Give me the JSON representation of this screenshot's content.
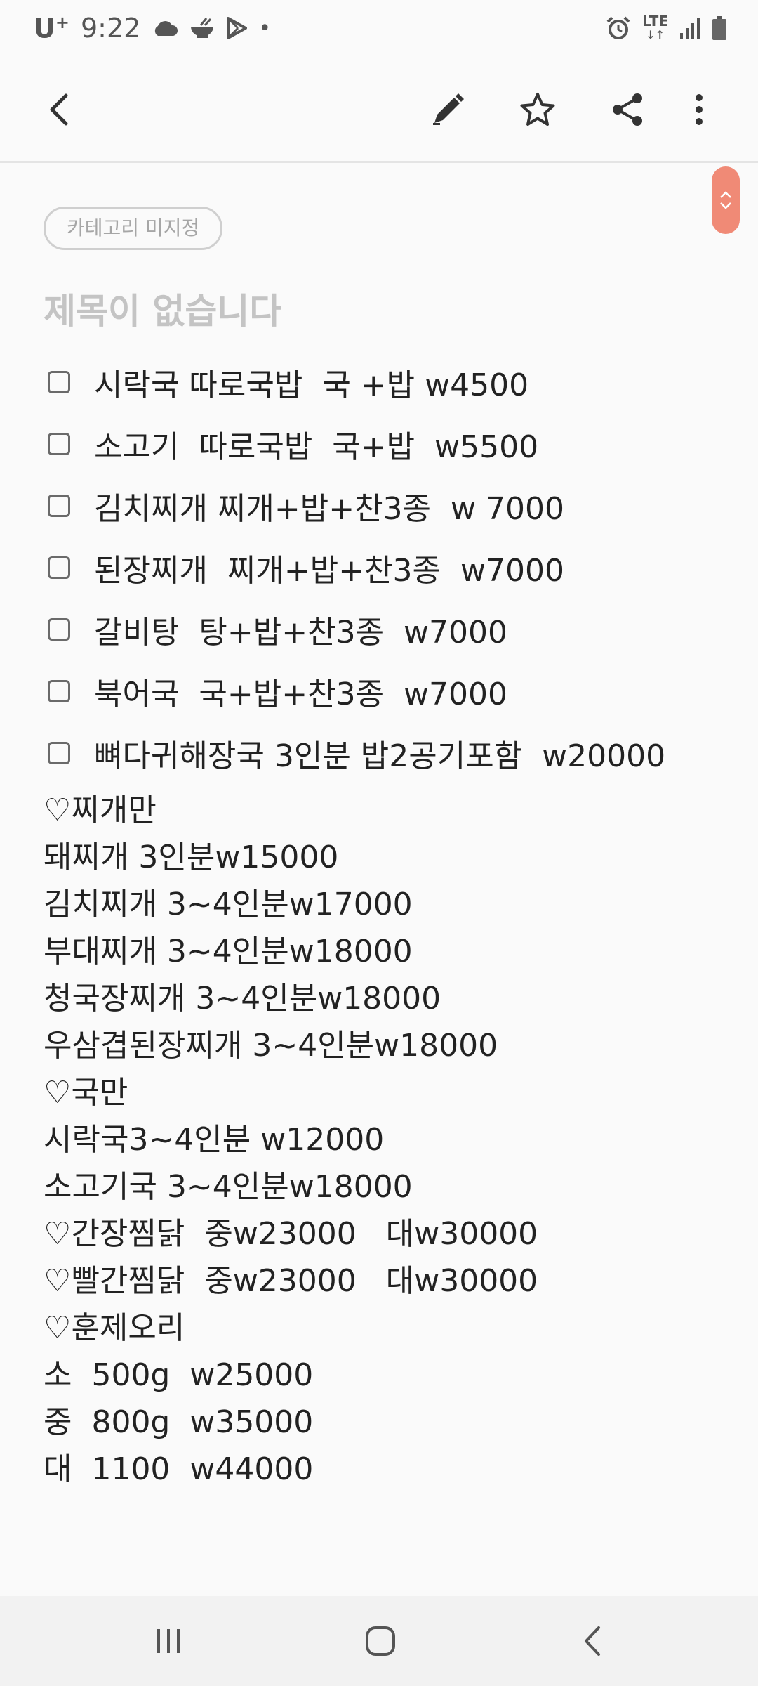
{
  "status_bar": {
    "carrier": "U",
    "carrier_sup": "+",
    "time": "9:22",
    "left_icons": [
      "cloud-icon",
      "food-bowl-icon",
      "play-store-icon"
    ],
    "dot": "•",
    "network": "LTE",
    "right_icons": [
      "alarm-icon",
      "lte-icon",
      "signal-icon",
      "battery-icon"
    ]
  },
  "app_bar": {
    "icons": [
      "back-icon",
      "edit-icon",
      "star-icon",
      "share-icon",
      "more-icon"
    ]
  },
  "note": {
    "category": "카테고리 미지정",
    "title": "제목이 없습니다",
    "checklist": [
      "시락국 따로국밥  국 +밥 w4500",
      "소고기  따로국밥  국+밥  w5500",
      "김치찌개 찌개+밥+찬3종  w 7000",
      "된장찌개  찌개+밥+찬3종  w7000",
      "갈비탕  탕+밥+찬3종  w7000",
      "북어국  국+밥+찬3종  w7000",
      "뼈다귀해장국 3인분 밥2공기포함  w20000"
    ],
    "lines": [
      "♡찌개만",
      "돼찌개 3인분w15000",
      "김치찌개 3~4인분w17000",
      "부대찌개 3~4인분w18000",
      "청국장찌개 3~4인분w18000",
      "우삼겹된장찌개 3~4인분w18000",
      "♡국만",
      "시락국3~4인분 w12000",
      "소고기국 3~4인분w18000",
      "♡간장찜닭  중w23000   대w30000",
      "♡빨간찜닭  중w23000   대w30000",
      "♡훈제오리",
      "소  500g  w25000",
      "중  800g  w35000",
      "대  1100  w44000"
    ]
  },
  "nav_bar": {
    "icons": [
      "recent-apps-icon",
      "home-icon",
      "nav-back-icon"
    ]
  },
  "colors": {
    "accent": "#f08a76",
    "background": "#fafafa",
    "title_placeholder": "#c4c4c4"
  }
}
